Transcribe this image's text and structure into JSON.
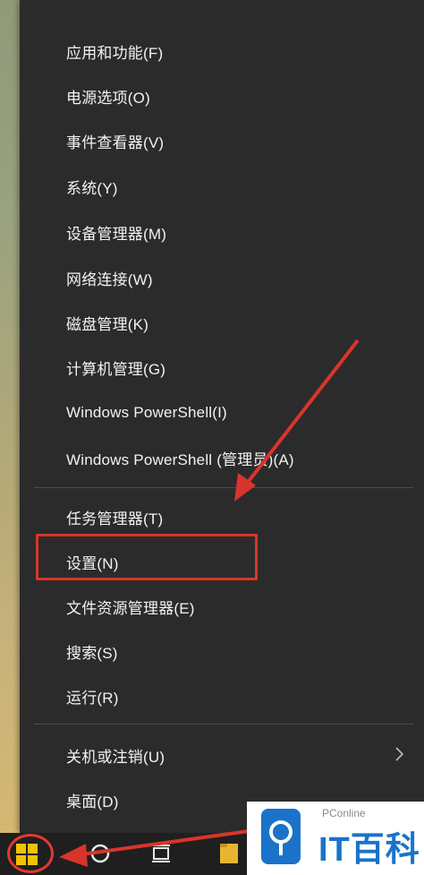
{
  "context_menu": {
    "group1": [
      "应用和功能(F)",
      "电源选项(O)",
      "事件查看器(V)",
      "系统(Y)",
      "设备管理器(M)",
      "网络连接(W)",
      "磁盘管理(K)",
      "计算机管理(G)",
      "Windows PowerShell(I)",
      "Windows PowerShell (管理员)(A)"
    ],
    "group2": [
      "任务管理器(T)",
      "设置(N)",
      "文件资源管理器(E)",
      "搜索(S)",
      "运行(R)"
    ],
    "group3": [
      "关机或注销(U)",
      "桌面(D)"
    ]
  },
  "watermark": {
    "small": "PConline",
    "big": "IT百科"
  },
  "colors": {
    "menu_bg": "#2b2b2b",
    "annotation": "#d9342b",
    "brand": "#1a73c9"
  }
}
